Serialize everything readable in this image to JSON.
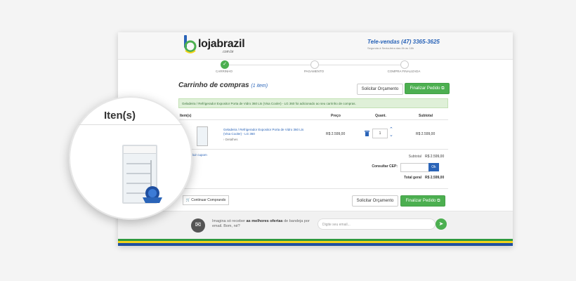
{
  "header": {
    "logo_text": "lojabrazil",
    "logo_sub": ".com.br",
    "tele_vendas": "Tele-vendas (47) 3365-3625",
    "tele_sub": "Segunda à Sexta-feira das 8h às 18h"
  },
  "steps": [
    {
      "label": "CARRINHO",
      "done": true
    },
    {
      "label": "PAGAMENTO",
      "done": false
    },
    {
      "label": "COMPRA FINALIZADA",
      "done": false
    }
  ],
  "cart": {
    "title": "Carrinho de compras",
    "count": "(1 item)",
    "solicitar_label": "Solicitar Orçamento",
    "finalizar_label": "Finalizar Pedido",
    "alert": "Geladeira / Refrigerador Expositor Porta de Vidro 360 Lts (Visa Cooler) - LG 360 foi adicionado ao seu carrinho de compras.",
    "headers": {
      "items": "Item(s)",
      "price": "Preço",
      "qty": "Quant.",
      "subtotal": "Subtotal"
    },
    "item": {
      "name": "Geladeira / Refrigerador Expositor Porta de Vidro 360 Lts (Visa Cooler) - LG 360",
      "details": "Detalhes",
      "price": "R$ 2.599,00",
      "qty": "1",
      "subtotal": "R$ 2.599,00"
    },
    "incluir_cupom": "Incluir cupom",
    "summary": {
      "subtotal_label": "Subtotal",
      "subtotal_value": "R$ 2.599,00",
      "cep_label": "Consultar CEP:",
      "cep_button": "Ok",
      "total_label": "Total geral",
      "total_value": "R$ 2.599,00"
    },
    "continuar_label": "Continuar Comprando"
  },
  "newsletter": {
    "text_before": "Imagina só receber ",
    "text_bold": "as melhores ofertas",
    "text_after": " de bandeja por email. Bom, né?",
    "placeholder": "Digite seu email..."
  },
  "magnifier": {
    "title": "Iten(s)"
  },
  "colors": {
    "green": "#4caf50",
    "blue": "#2a64b8",
    "stripe_green": "#2e9a3e",
    "stripe_yellow": "#f2d31b",
    "stripe_blue": "#1f4fa0"
  },
  "icons": {
    "check": "check-icon",
    "trash": "trash-icon",
    "mail": "mail-icon",
    "send": "send-icon",
    "cart": "cart-icon"
  }
}
